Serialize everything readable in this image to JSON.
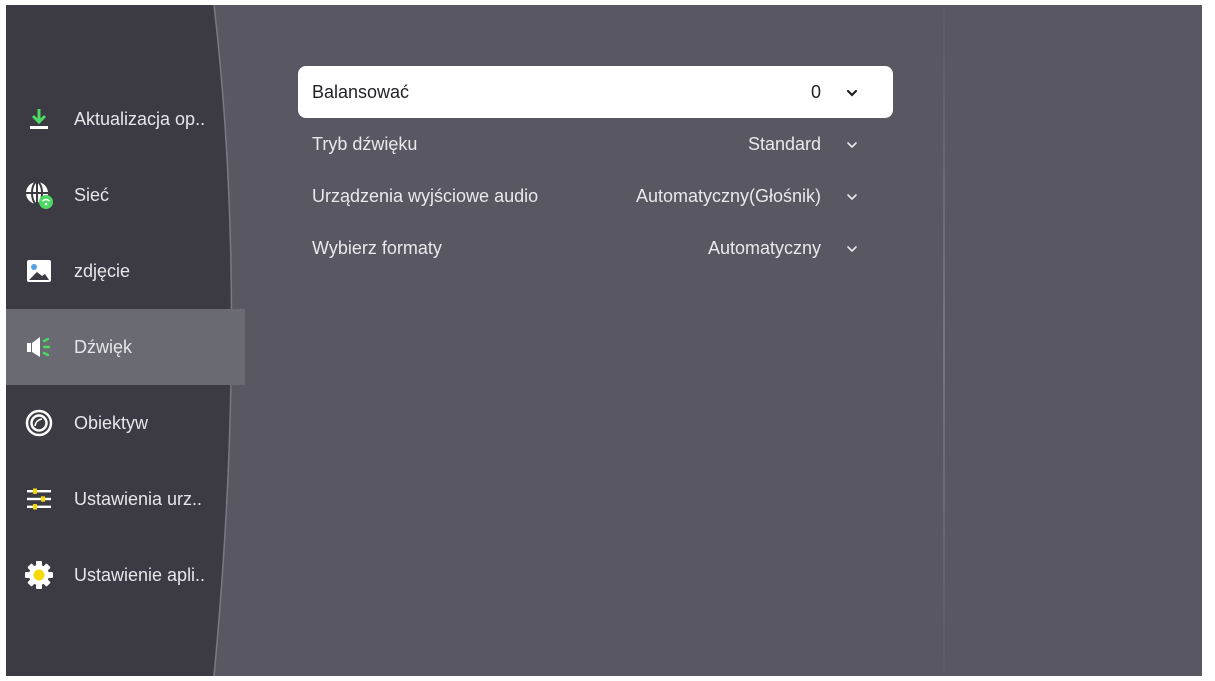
{
  "menu": {
    "items": [
      {
        "label": "Aktualizacja op..",
        "icon": "download-icon"
      },
      {
        "label": "Sieć",
        "icon": "network-globe-icon"
      },
      {
        "label": "zdjęcie",
        "icon": "picture-icon"
      },
      {
        "label": "Dźwięk",
        "icon": "speaker-icon",
        "active": true
      },
      {
        "label": "Obiektyw",
        "icon": "lens-icon"
      },
      {
        "label": "Ustawienia urz..",
        "icon": "sliders-icon"
      },
      {
        "label": "Ustawienie apli..",
        "icon": "gear-icon"
      }
    ]
  },
  "settings": {
    "rows": [
      {
        "label": "Balansować",
        "value": "0",
        "focused": true
      },
      {
        "label": "Tryb dźwięku",
        "value": "Standard"
      },
      {
        "label": "Urządzenia wyjściowe audio",
        "value": "Automatyczny(Głośnik)"
      },
      {
        "label": "Wybierz formaty",
        "value": "Automatyczny"
      }
    ]
  },
  "colors": {
    "background": "#595862",
    "sidebar": "#3c3b43",
    "active_item": "#6a6a72",
    "accent_green": "#4cd964",
    "accent_yellow": "#f5d90a"
  }
}
